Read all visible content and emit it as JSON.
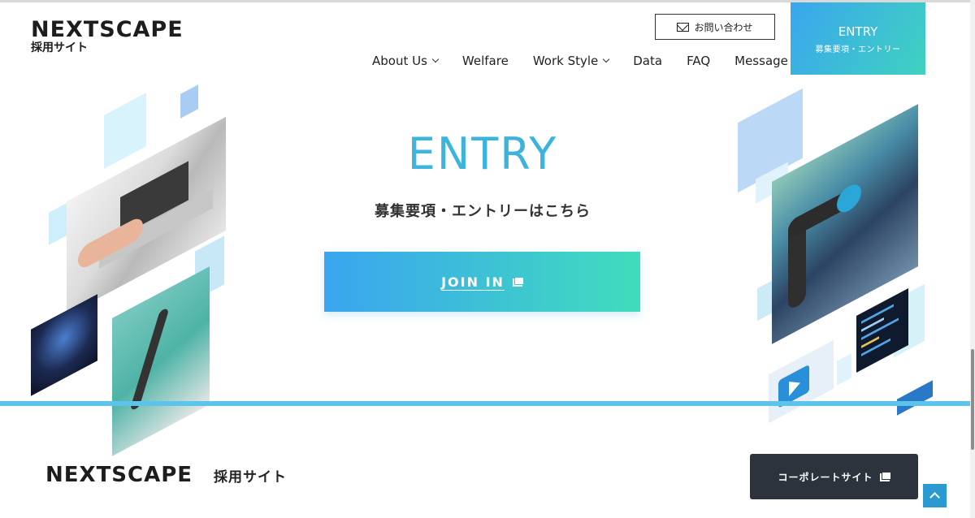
{
  "header": {
    "logo_main": "NEXTSCAPE",
    "logo_sub": "採用サイト",
    "contact_label": "お問い合わせ",
    "entry_title": "ENTRY",
    "entry_sub": "募集要項・エントリー",
    "nav": [
      {
        "label": "About Us",
        "has_dropdown": true
      },
      {
        "label": "Welfare",
        "has_dropdown": false
      },
      {
        "label": "Work Style",
        "has_dropdown": true
      },
      {
        "label": "Data",
        "has_dropdown": false
      },
      {
        "label": "FAQ",
        "has_dropdown": false
      },
      {
        "label": "Message",
        "has_dropdown": false
      }
    ]
  },
  "hero": {
    "title": "ENTRY",
    "subtitle": "募集要項・エントリーはこちら",
    "button_label": "JOIN IN"
  },
  "footer": {
    "logo_main": "NEXTSCAPE",
    "logo_sub": "採用サイト",
    "corporate_label": "コーポレートサイト"
  },
  "colors": {
    "accent_start": "#3aa5f0",
    "accent_end": "#40dcbc",
    "title": "#33b6d8",
    "dark_button": "#2c333d",
    "band": "#5ec3ea"
  },
  "icons": [
    "mail-icon",
    "chevron-down-icon",
    "external-link-icon",
    "chevron-up-icon"
  ]
}
